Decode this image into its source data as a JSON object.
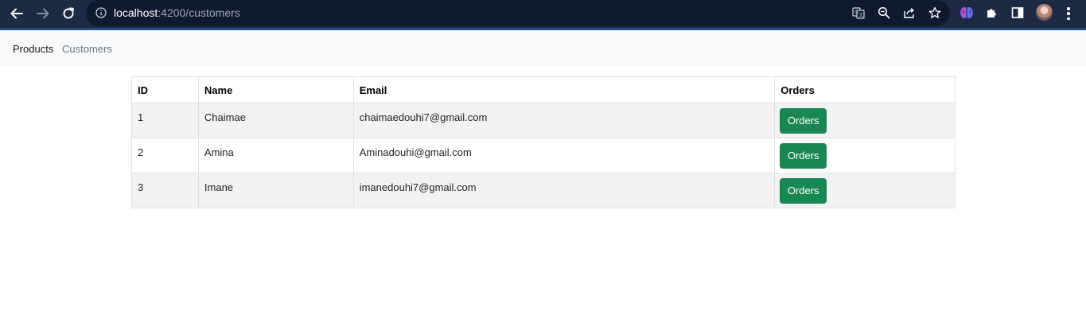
{
  "browser": {
    "url_host": "localhost",
    "url_path": ":4200/customers"
  },
  "nav": {
    "links": [
      {
        "label": "Products"
      },
      {
        "label": "Customers"
      }
    ]
  },
  "table": {
    "headers": [
      "ID",
      "Name",
      "Email",
      "Orders"
    ],
    "rows": [
      {
        "id": "1",
        "name": "Chaimae",
        "email": "chaimaedouhi7@gmail.com",
        "action": "Orders"
      },
      {
        "id": "2",
        "name": "Amina",
        "email": "Aminadouhi@gmail.com",
        "action": "Orders"
      },
      {
        "id": "3",
        "name": "Imane",
        "email": "imanedouhi7@gmail.com",
        "action": "Orders"
      }
    ]
  },
  "colors": {
    "chrome_bg": "#1d2a44",
    "navbar_bg": "#f8f9fa",
    "button_bg": "#198754",
    "row_stripe": "#f2f2f2"
  },
  "icons": [
    "back-arrow-icon",
    "forward-arrow-icon",
    "reload-icon",
    "info-icon",
    "translate-icon",
    "zoom-icon",
    "share-icon",
    "star-icon",
    "brain-extension-icon",
    "puzzle-icon",
    "side-panel-icon",
    "avatar",
    "more-menu-icon"
  ]
}
